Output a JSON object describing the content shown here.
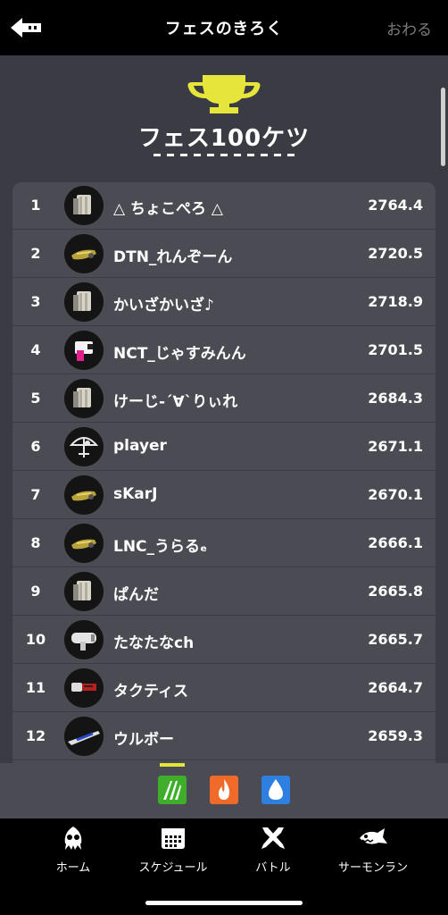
{
  "header": {
    "title": "フェスのきろく",
    "end_label": "おわる"
  },
  "section": {
    "title": "フェス100ケツ"
  },
  "rankings": [
    {
      "rank": "1",
      "name": "△ ちょこぺろ △",
      "score": "2764.4",
      "weapon": "roller-icon"
    },
    {
      "rank": "2",
      "name": "DTN_れんぞーん",
      "score": "2720.5",
      "weapon": "blaster-icon"
    },
    {
      "rank": "3",
      "name": "かいざかいざ♪",
      "score": "2718.9",
      "weapon": "roller-icon"
    },
    {
      "rank": "4",
      "name": "NCT_じゃすみんん",
      "score": "2701.5",
      "weapon": "shooter-icon"
    },
    {
      "rank": "5",
      "name": "けーじ-´∀`りぃれ",
      "score": "2684.3",
      "weapon": "roller-icon"
    },
    {
      "rank": "6",
      "name": "player",
      "score": "2671.1",
      "weapon": "brella-icon"
    },
    {
      "rank": "7",
      "name": "sKarJ",
      "score": "2670.1",
      "weapon": "blaster-icon"
    },
    {
      "rank": "8",
      "name": "LNC_うらるₑ",
      "score": "2666.1",
      "weapon": "blaster-icon"
    },
    {
      "rank": "9",
      "name": "ぱんだ",
      "score": "2665.8",
      "weapon": "roller-icon"
    },
    {
      "rank": "10",
      "name": "たなたなch",
      "score": "2665.7",
      "weapon": "launcher-icon"
    },
    {
      "rank": "11",
      "name": "タクティス",
      "score": "2664.7",
      "weapon": "splatling-icon"
    },
    {
      "rank": "12",
      "name": "ウルボー",
      "score": "2659.3",
      "weapon": "charger-icon"
    }
  ],
  "teams": [
    {
      "name": "team-green",
      "color": "#3fae2a"
    },
    {
      "name": "team-fire",
      "color": "#f06a2a"
    },
    {
      "name": "team-water",
      "color": "#2f7fe0"
    }
  ],
  "nav": [
    {
      "label": "ホーム",
      "icon": "squid-icon"
    },
    {
      "label": "スケジュール",
      "icon": "calendar-icon"
    },
    {
      "label": "バトル",
      "icon": "crossed-weapons-icon"
    },
    {
      "label": "サーモンラン",
      "icon": "salmon-icon"
    }
  ],
  "colors": {
    "accent": "#e6e63a",
    "background": "#3b3c43",
    "panel": "#4a4b53"
  }
}
